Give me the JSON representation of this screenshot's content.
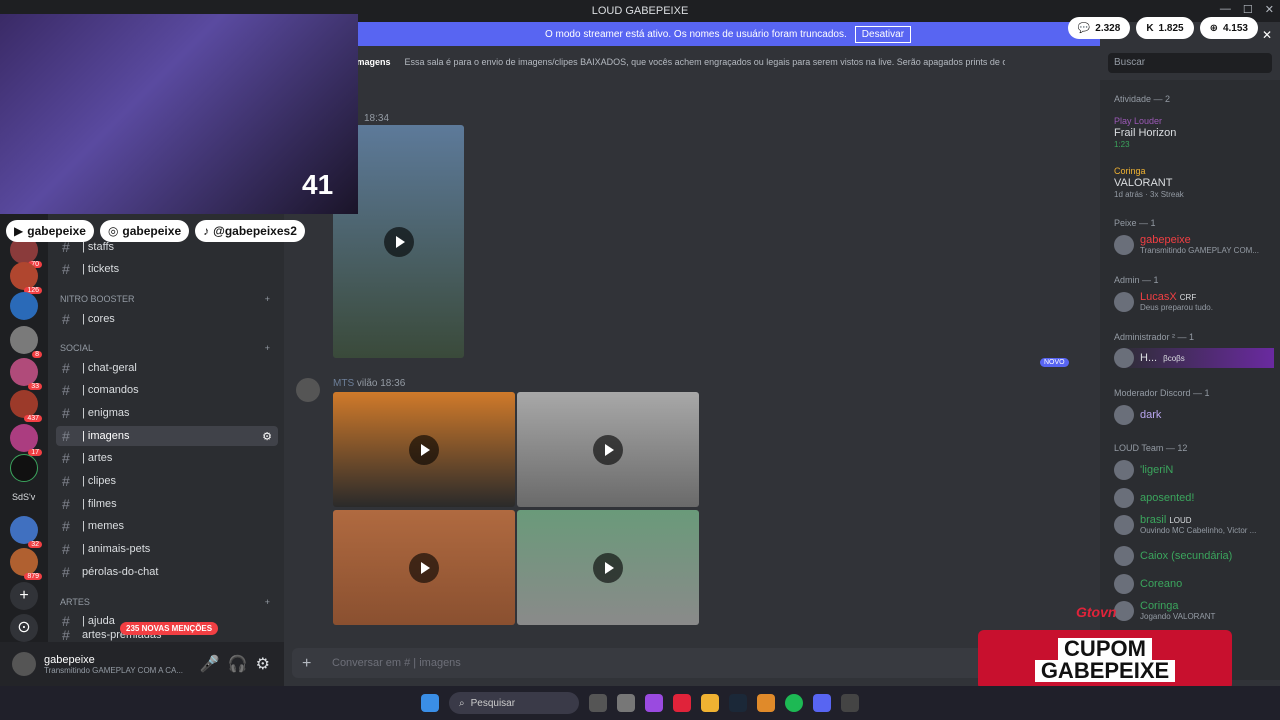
{
  "window": {
    "title": "LOUD GABEPEIXE"
  },
  "streamer_bar": {
    "message": "O modo streamer está ativo. Os nomes de usuário foram truncados.",
    "button": "Desativar"
  },
  "stats": [
    {
      "icon": "chat-icon",
      "value": "2.328"
    },
    {
      "icon": "kick-icon",
      "value": "1.825"
    },
    {
      "icon": "globe-icon",
      "value": "4.153"
    }
  ],
  "channel": {
    "name": "imagens",
    "topic": "Essa sala é para o envio de imagens/clipes BAIXADOS, que vocês achem engraçados ou legais para serem vistos na live. Serão apagados prints de ou..."
  },
  "search": {
    "placeholder": "Buscar"
  },
  "socials": [
    "gabepeixe",
    "gabepeixe",
    "@gabepeixes2"
  ],
  "webcam_number": "41",
  "categories": {
    "nitro": "NITRO BOOSTER",
    "social": "SOCIAL",
    "artes": "ARTES"
  },
  "channels_top": [
    {
      "label": "| staffs"
    },
    {
      "label": "| tickets"
    }
  ],
  "channel_nitro": [
    {
      "label": "| cores"
    }
  ],
  "channels_social": [
    {
      "label": "| chat-geral"
    },
    {
      "label": "| comandos"
    },
    {
      "label": "| enigmas"
    },
    {
      "label": "| imagens"
    },
    {
      "label": "| artes"
    },
    {
      "label": "| clipes"
    },
    {
      "label": "| filmes"
    },
    {
      "label": "| memes"
    },
    {
      "label": "| animais-pets"
    },
    {
      "label": "pérolas-do-chat"
    }
  ],
  "channels_artes": [
    {
      "label": "| ajuda"
    },
    {
      "label": "artes-premiadas"
    }
  ],
  "mentions_badge": "235 NOVAS MENÇÕES",
  "user": {
    "name": "gabepeixe",
    "status": "Transmitindo GAMEPLAY COM A CA..."
  },
  "server_badges": [
    "70",
    "126",
    "8",
    "33",
    "437",
    "17",
    "32",
    "879"
  ],
  "server_label": "SdS'v",
  "messages": [
    {
      "time": "18:34"
    },
    {
      "author": "MTS",
      "tag": "vilão",
      "time": "18:36",
      "new_label": "NOVO"
    }
  ],
  "composer": {
    "placeholder": "Conversar em # | imagens"
  },
  "members": {
    "activity_header": "Atividade — 2",
    "activity": [
      {
        "name": "Play Louder",
        "detail": "Frail Horizon",
        "extra": "1:23"
      },
      {
        "name": "Coringa",
        "detail": "VALORANT",
        "extra": "1d atrás · 3x Streak"
      }
    ],
    "sections": [
      {
        "header": "Peixe — 1",
        "users": [
          {
            "name": "gabepeixe",
            "sub": "Transmitindo GAMEPLAY COM..."
          }
        ]
      },
      {
        "header": "Admin — 1",
        "users": [
          {
            "name": "LucasX",
            "badge": "CRF",
            "sub": "Deus preparou tudo."
          }
        ]
      },
      {
        "header": "Administrador ² — 1",
        "users": [
          {
            "name": "H...",
            "badge": "βcoβs"
          }
        ]
      },
      {
        "header": "Moderador Discord — 1",
        "users": [
          {
            "name": "dark"
          }
        ]
      },
      {
        "header": "LOUD Team — 12",
        "users": [
          {
            "name": "'ligeriN"
          },
          {
            "name": "aposented!"
          },
          {
            "name": "brasil",
            "badge": "LOUD",
            "sub": "Ouvindo MC Cabelinho, Victor ..."
          },
          {
            "name": "Caiox (secundária)"
          },
          {
            "name": "Coreano"
          },
          {
            "name": "Coringa",
            "sub": "Jogando VALORANT"
          }
        ]
      }
    ]
  },
  "cupom": {
    "line1": "CUPOM",
    "line2": "GABEPEIXE"
  },
  "overlay_logo": "Gtovn",
  "taskbar": {
    "search": "Pesquisar"
  },
  "colors": {
    "accent": "#5865f2",
    "bg": "#313338",
    "sidebar": "#2b2d31",
    "red": "#f23f43"
  }
}
